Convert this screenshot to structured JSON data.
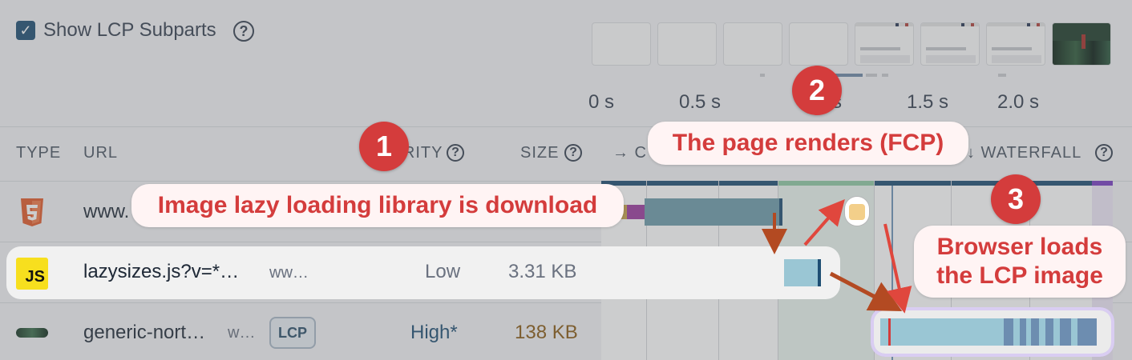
{
  "toolbar": {
    "show_lcp_label": "Show LCP Subparts",
    "checkbox_mark": "✓",
    "help_glyph": "?"
  },
  "timeline": {
    "ticks": [
      "0 s",
      "0.5 s",
      "1 s",
      "1.5 s",
      "2.0 s"
    ]
  },
  "table": {
    "headers": {
      "type": "TYPE",
      "url": "URL",
      "priority": "PRIORITY",
      "size": "SIZE",
      "connection": "→ C",
      "waterfall": "↓ WATERFALL"
    },
    "rows": [
      {
        "type_icon": "html5-icon",
        "url": "www.",
        "domain": "",
        "priority": "",
        "size": ""
      },
      {
        "type_icon": "javascript-icon",
        "icon_text": "JS",
        "url": "lazysizes.js?v=*…",
        "domain": "ww…",
        "priority": "Low",
        "size": "3.31 KB"
      },
      {
        "type_icon": "image-icon",
        "url": "generic-nort…",
        "domain": "w…",
        "badge": "LCP",
        "priority": "High*",
        "size": "138 KB"
      }
    ]
  },
  "callouts": [
    {
      "number": "1",
      "text": "Image lazy loading library is download"
    },
    {
      "number": "2",
      "text": "The page renders (FCP)"
    },
    {
      "number": "3",
      "text": "Browser loads the LCP image",
      "line1": "Browser loads",
      "line2": "the LCP image"
    }
  ],
  "colors": {
    "accent_red": "#d43c3c",
    "waterfall_blue": "#1e4e73",
    "waterfall_green": "#8fc9a5",
    "waterfall_purple": "#7a3ec2",
    "priority_high": "#1e4e73",
    "size_large": "#8a5a14"
  }
}
